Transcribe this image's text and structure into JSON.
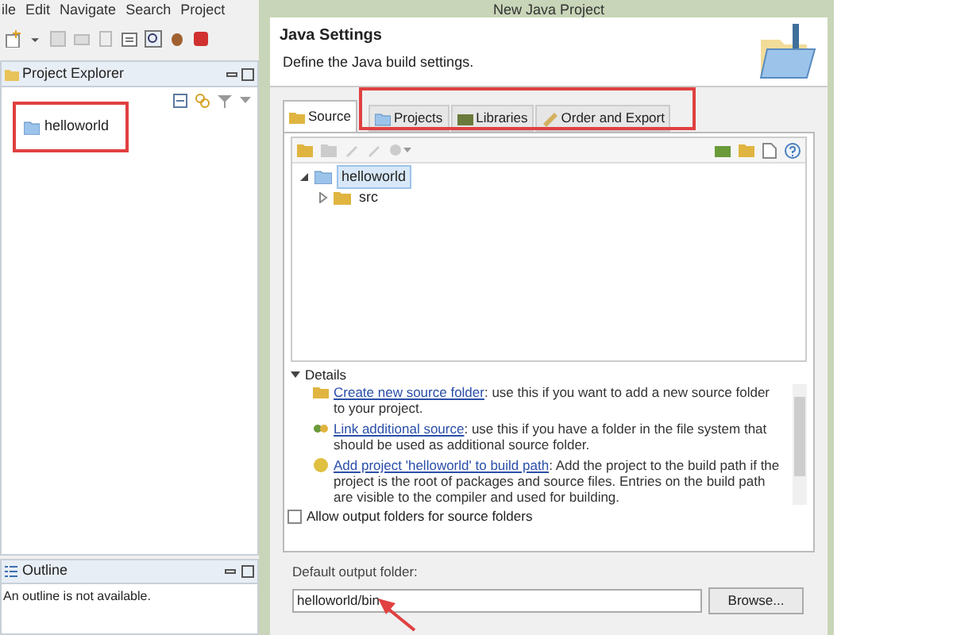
{
  "menu": [
    "ile",
    "Edit",
    "Navigate",
    "Search",
    "Project"
  ],
  "explorer": {
    "title": "Project Explorer",
    "items": [
      {
        "label": "helloworld"
      }
    ]
  },
  "outline": {
    "title": "Outline",
    "message": "An outline is not available."
  },
  "dialog": {
    "title": "New Java Project",
    "header_title": "Java Settings",
    "header_description": "Define the Java build settings.",
    "tabs": [
      {
        "label": "Source",
        "selected": true
      },
      {
        "label": "Projects",
        "selected": false
      },
      {
        "label": "Libraries",
        "selected": false
      },
      {
        "label": "Order and Export",
        "selected": false
      }
    ],
    "tree": [
      {
        "label": "helloworld",
        "selected": true,
        "expanded": true,
        "children": [
          {
            "label": "src",
            "selected": false,
            "expanded": false
          }
        ]
      }
    ],
    "details": {
      "label": "Details",
      "expanded": true,
      "entries": [
        {
          "link": "Create new source folder",
          "text": ": use this if you want to add a new source folder to your project."
        },
        {
          "link": "Link additional source",
          "text": ": use this if you have a folder in the file system that should be used as additional source folder."
        },
        {
          "link": "Add project 'helloworld' to build path",
          "text": ": Add the project to the build path if the project is the root of packages and source files. Entries on the build path are visible to the compiler and used for building."
        }
      ]
    },
    "allow_output_folders": {
      "label": "Allow output folders for source folders",
      "checked": false
    },
    "output_folder": {
      "label": "Default output folder:",
      "value": "helloworld/bin"
    },
    "browse_button": "Browse..."
  }
}
